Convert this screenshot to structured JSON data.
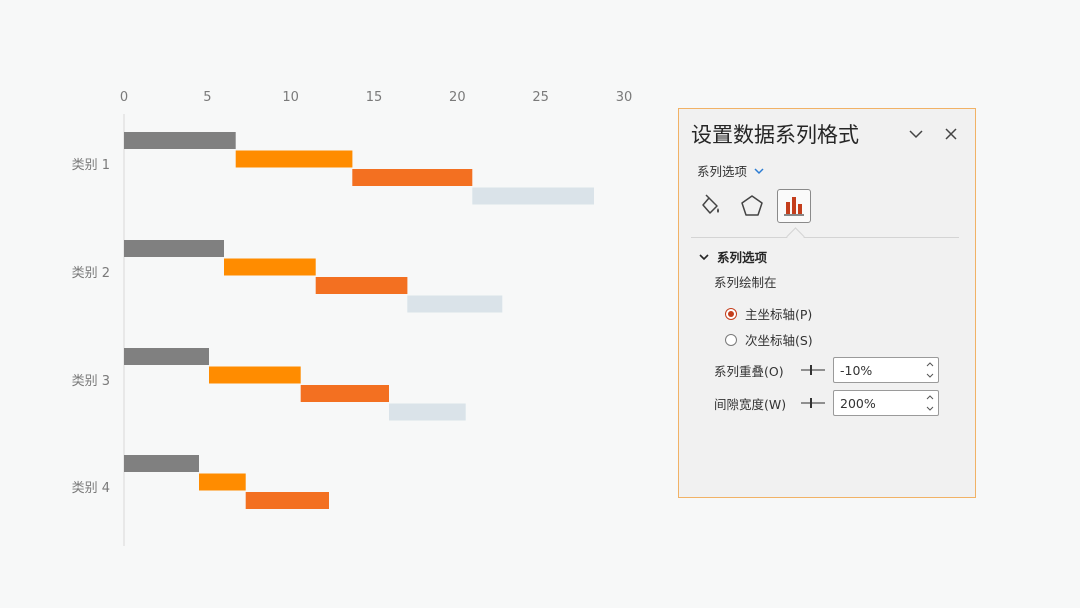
{
  "chart_data": {
    "type": "bar",
    "orientation": "horizontal",
    "stacked": true,
    "categories": [
      "类别 1",
      "类别 2",
      "类别 3",
      "类别 4"
    ],
    "series": [
      {
        "color": "#808080",
        "values": [
          6.7,
          6.0,
          5.1,
          4.5
        ]
      },
      {
        "color": "#ff8c00",
        "values": [
          7.0,
          5.5,
          5.5,
          2.8
        ]
      },
      {
        "color": "#f37021",
        "values": [
          7.2,
          5.5,
          5.3,
          5.0
        ]
      },
      {
        "color": "#dae3e9",
        "values": [
          7.3,
          5.7,
          4.6,
          0
        ]
      }
    ],
    "x_ticks": [
      "0",
      "5",
      "10",
      "15",
      "20",
      "25",
      "30"
    ],
    "xlim": [
      0,
      30
    ],
    "axis_position": "top",
    "series_overlap": "-10%",
    "gap_width": "200%",
    "grid": false,
    "legend": false
  },
  "pane": {
    "title": "设置数据系列格式",
    "menu_label": "系列选项",
    "section_title": "系列选项",
    "plot_on_label": "系列绘制在",
    "primary_axis_label": "主坐标轴(P)",
    "secondary_axis_label": "次坐标轴(S)",
    "selected_axis": "primary",
    "overlap_label": "系列重叠(O)",
    "overlap_value": "-10%",
    "gap_label": "间隙宽度(W)",
    "gap_value": "200%",
    "tabs": [
      {
        "icon": "paint-bucket-icon",
        "active": false
      },
      {
        "icon": "pentagon-icon",
        "active": false
      },
      {
        "icon": "bar-chart-icon",
        "active": true
      }
    ],
    "accent_color": "#c43e1c",
    "border_color": "#f1b266"
  }
}
